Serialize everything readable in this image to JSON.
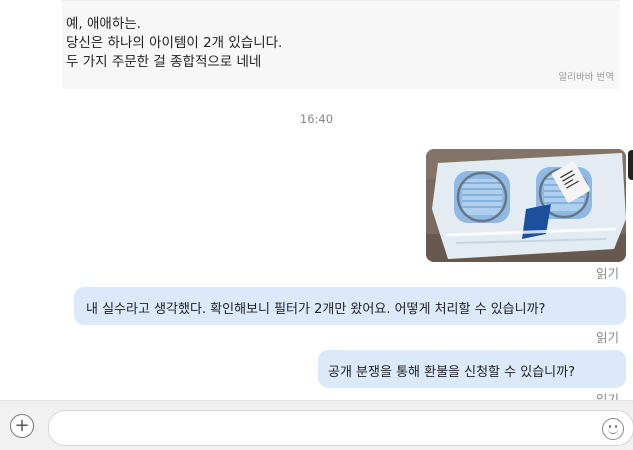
{
  "received": {
    "lines": [
      "예, 애애하는.",
      "당신은 하나의 아이템이 2개 있습니다.",
      "두 가지 주문한 걸 종합적으로 네네"
    ],
    "translate_label": "알리바바 번역"
  },
  "timestamp": "16:40",
  "sent": {
    "photo_read_label": "읽기",
    "msg1": {
      "text": "내 실수라고 생각했다. 확인해보니 필터가 2개만 왔어요. 어떻게 처리할 수 있습니까?",
      "read": "읽기"
    },
    "msg2": {
      "text": "공개 분쟁을 통해 환불을 신청할 수 있습니까?",
      "read": "읽기"
    }
  },
  "input": {
    "value": "",
    "placeholder": ""
  },
  "icons": {
    "add": "plus-icon",
    "emoji": "smiley-icon",
    "photo": "product-photo"
  },
  "colors": {
    "sent_bubble": "#dbe9fb",
    "received_bg": "#f7f7f7",
    "input_bar": "#f1f1f1"
  }
}
